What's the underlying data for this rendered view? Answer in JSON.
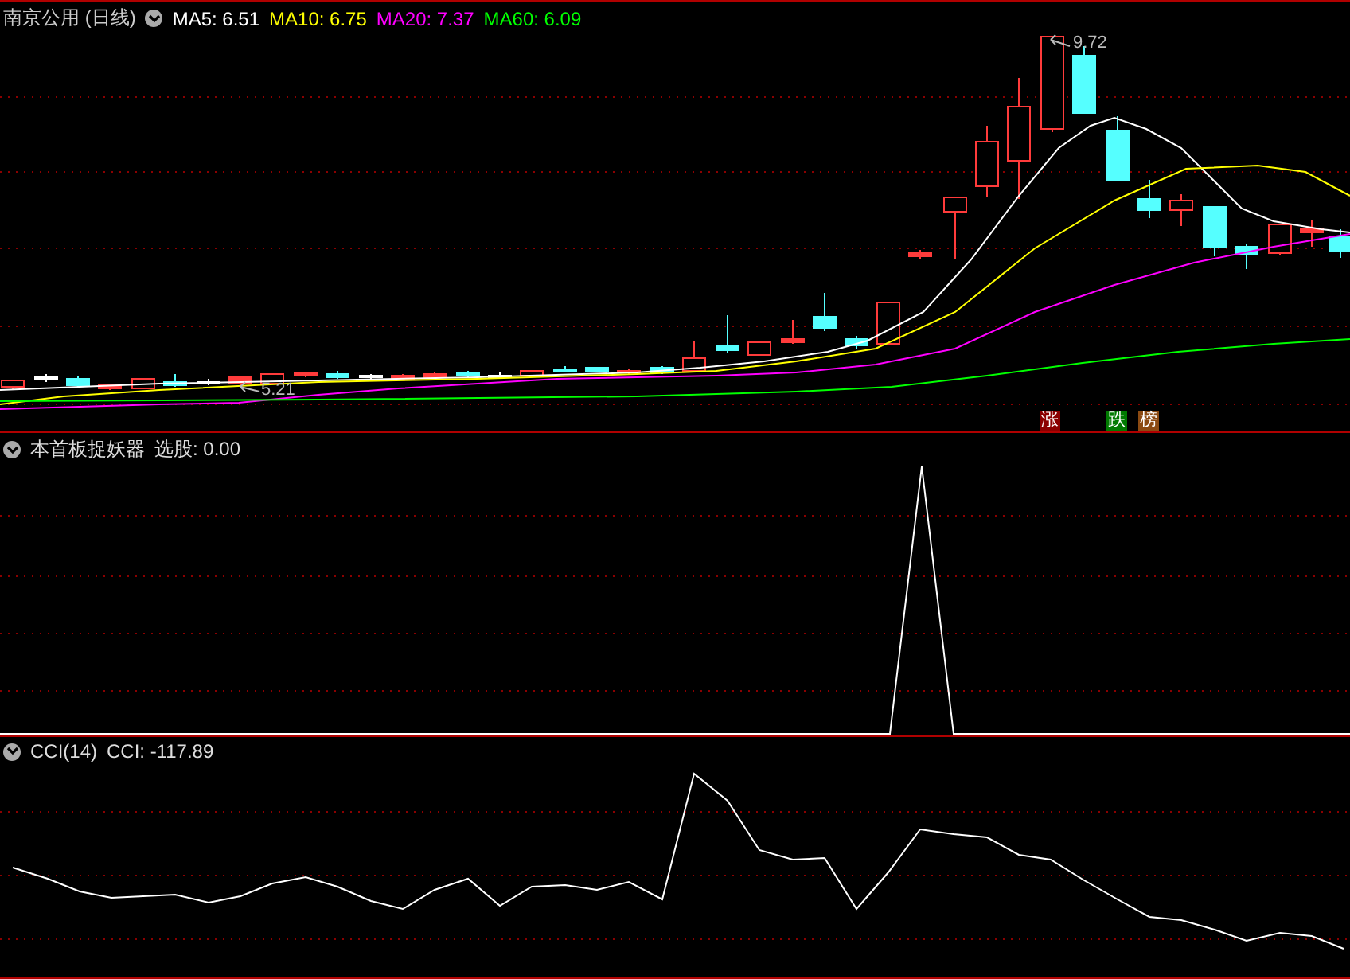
{
  "price_panel": {
    "title": "南京公用 (日线)",
    "series": [
      {
        "label": "MA5: 6.51",
        "color": "#ffffff"
      },
      {
        "label": "MA10: 6.75",
        "color": "#ffff00"
      },
      {
        "label": "MA20: 7.37",
        "color": "#ff00ff"
      },
      {
        "label": "MA60: 6.09",
        "color": "#00ff00"
      }
    ],
    "high_label": "9.72",
    "low_label": "5.21",
    "markers": [
      {
        "text": "涨",
        "color": "#8b0000"
      },
      {
        "text": "跌",
        "color": "#007a00"
      },
      {
        "text": "榜",
        "color": "#8b4a12"
      }
    ]
  },
  "signal_panel": {
    "name": "本首板捉妖器",
    "reading": "选股: 0.00"
  },
  "cci_panel": {
    "name": "CCI(14)",
    "reading": "CCI: -117.89"
  }
}
